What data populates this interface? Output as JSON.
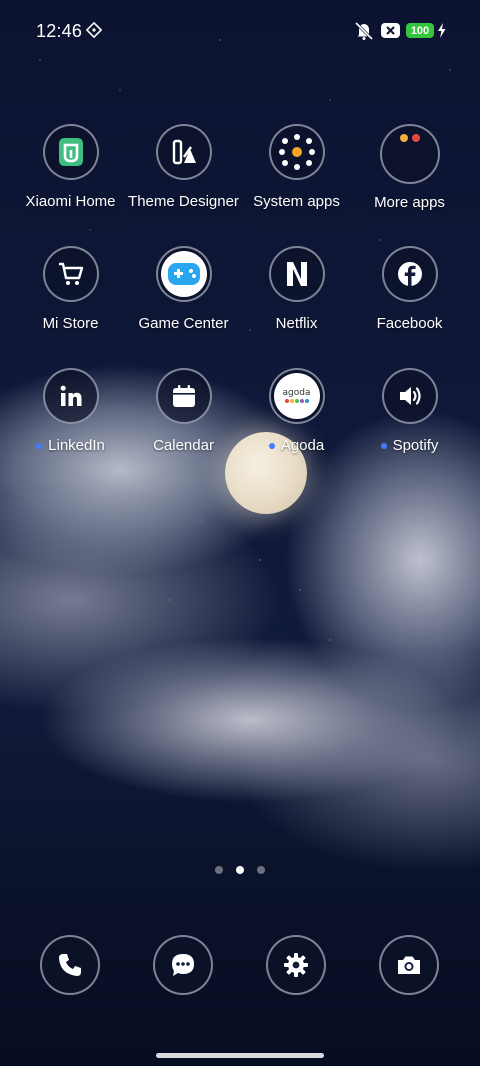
{
  "status_bar": {
    "time": "12:46",
    "battery_level": "100",
    "battery_color": "#35c53c",
    "icons": [
      "network-sync-icon",
      "vibrate-off-icon",
      "notification-x-icon",
      "battery-icon",
      "charging-bolt-icon"
    ]
  },
  "home_screen": {
    "apps": [
      {
        "label": "Xiaomi Home",
        "icon": "mi-home-icon",
        "new": false
      },
      {
        "label": "Theme Designer",
        "icon": "theme-designer-icon",
        "new": false
      },
      {
        "label": "System apps",
        "icon": "folder-icon",
        "new": false
      },
      {
        "label": "More apps",
        "icon": "folder-icon",
        "new": false
      },
      {
        "label": "Mi Store",
        "icon": "cart-icon",
        "new": false
      },
      {
        "label": "Game Center",
        "icon": "gamepad-icon",
        "new": false
      },
      {
        "label": "Netflix",
        "icon": "netflix-icon",
        "new": false
      },
      {
        "label": "Facebook",
        "icon": "facebook-icon",
        "new": false
      },
      {
        "label": "LinkedIn",
        "icon": "linkedin-icon",
        "new": true
      },
      {
        "label": "Calendar",
        "icon": "calendar-icon",
        "new": false
      },
      {
        "label": "Agoda",
        "icon": "agoda-icon",
        "new": true
      },
      {
        "label": "Spotify",
        "icon": "spotify-icon",
        "new": true
      }
    ],
    "agoda_logo_text": "agoda",
    "page_indicator": {
      "count": 3,
      "active_index": 1
    },
    "new_app_dot_color": "#3f7cff"
  },
  "dock": {
    "items": [
      "phone-icon",
      "messages-icon",
      "settings-icon",
      "camera-icon"
    ]
  }
}
